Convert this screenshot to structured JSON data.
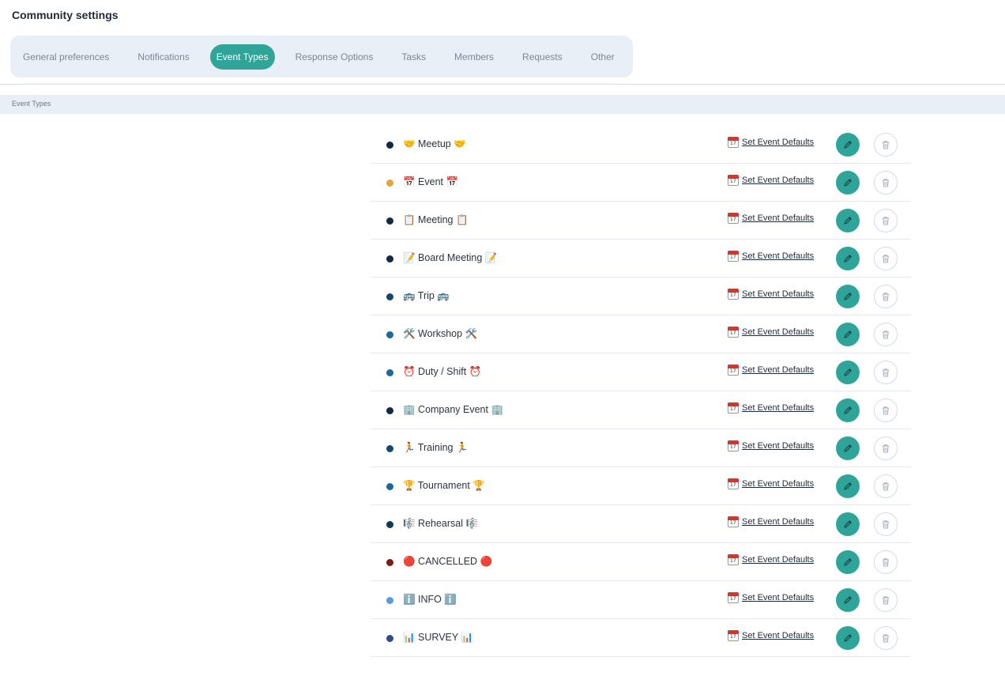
{
  "page": {
    "title": "Community settings"
  },
  "tabs": [
    {
      "label": "General preferences",
      "active": false
    },
    {
      "label": "Notifications",
      "active": false
    },
    {
      "label": "Event Types",
      "active": true
    },
    {
      "label": "Response Options",
      "active": false
    },
    {
      "label": "Tasks",
      "active": false
    },
    {
      "label": "Members",
      "active": false
    },
    {
      "label": "Requests",
      "active": false
    },
    {
      "label": "Other",
      "active": false
    }
  ],
  "section": {
    "label": "Event Types"
  },
  "colors": {
    "accent": "#2fa59a",
    "tab_bg": "#e8eff6"
  },
  "event_types": [
    {
      "label": "🤝 Meetup 🤝",
      "color": "#0d2b45",
      "defaults_label": "Set Event Defaults"
    },
    {
      "label": "📅 Event 📅",
      "color": "#e8a13a",
      "defaults_label": "Set Event Defaults"
    },
    {
      "label": "📋 Meeting 📋",
      "color": "#0d2b45",
      "defaults_label": "Set Event Defaults"
    },
    {
      "label": "📝 Board Meeting 📝",
      "color": "#0d2b45",
      "defaults_label": "Set Event Defaults"
    },
    {
      "label": "🚌 Trip 🚌",
      "color": "#114a6e",
      "defaults_label": "Set Event Defaults"
    },
    {
      "label": "🛠️ Workshop 🛠️",
      "color": "#1b6a9a",
      "defaults_label": "Set Event Defaults"
    },
    {
      "label": "⏰ Duty / Shift ⏰",
      "color": "#1b6a9a",
      "defaults_label": "Set Event Defaults"
    },
    {
      "label": "🏢 Company Event 🏢",
      "color": "#0d2b45",
      "defaults_label": "Set Event Defaults"
    },
    {
      "label": "🏃 Training 🏃",
      "color": "#114a6e",
      "defaults_label": "Set Event Defaults"
    },
    {
      "label": "🏆 Tournament 🏆",
      "color": "#1b6a9a",
      "defaults_label": "Set Event Defaults"
    },
    {
      "label": "🎼 Rehearsal 🎼",
      "color": "#0d3a55",
      "defaults_label": "Set Event Defaults"
    },
    {
      "label": "🔴 CANCELLED 🔴",
      "color": "#7a1a12",
      "defaults_label": "Set Event Defaults"
    },
    {
      "label": "ℹ️ INFO ℹ️",
      "color": "#5b9ad8",
      "defaults_label": "Set Event Defaults"
    },
    {
      "label": "📊 SURVEY 📊",
      "color": "#2e4c8a",
      "defaults_label": "Set Event Defaults"
    }
  ]
}
